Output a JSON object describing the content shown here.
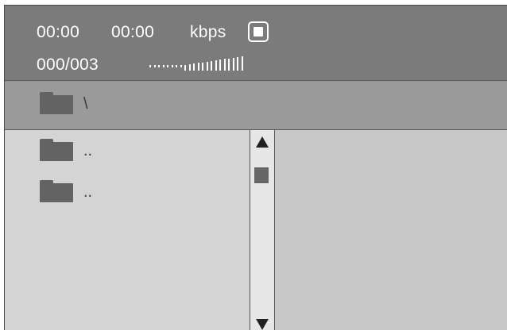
{
  "status": {
    "elapsed_time": "00:00",
    "total_time": "00:00",
    "bitrate_unit": "kbps",
    "track_counter": "000/003",
    "stop_icon": "stop-square-icon",
    "volume_level": 0.55
  },
  "path": {
    "folder_icon": "folder-icon",
    "current_path": "\\"
  },
  "file_list": {
    "items": [
      {
        "icon": "folder-icon",
        "label": ".."
      },
      {
        "icon": "folder-icon",
        "label": ".."
      }
    ]
  },
  "scrollbar": {
    "up_icon": "arrow-up-icon",
    "down_icon": "arrow-down-icon"
  },
  "colors": {
    "topbar": "#7b7b7b",
    "pathbar": "#9a9a9a",
    "list_bg": "#d4d4d4",
    "preview_bg": "#c8c8c8",
    "folder": "#636363"
  }
}
